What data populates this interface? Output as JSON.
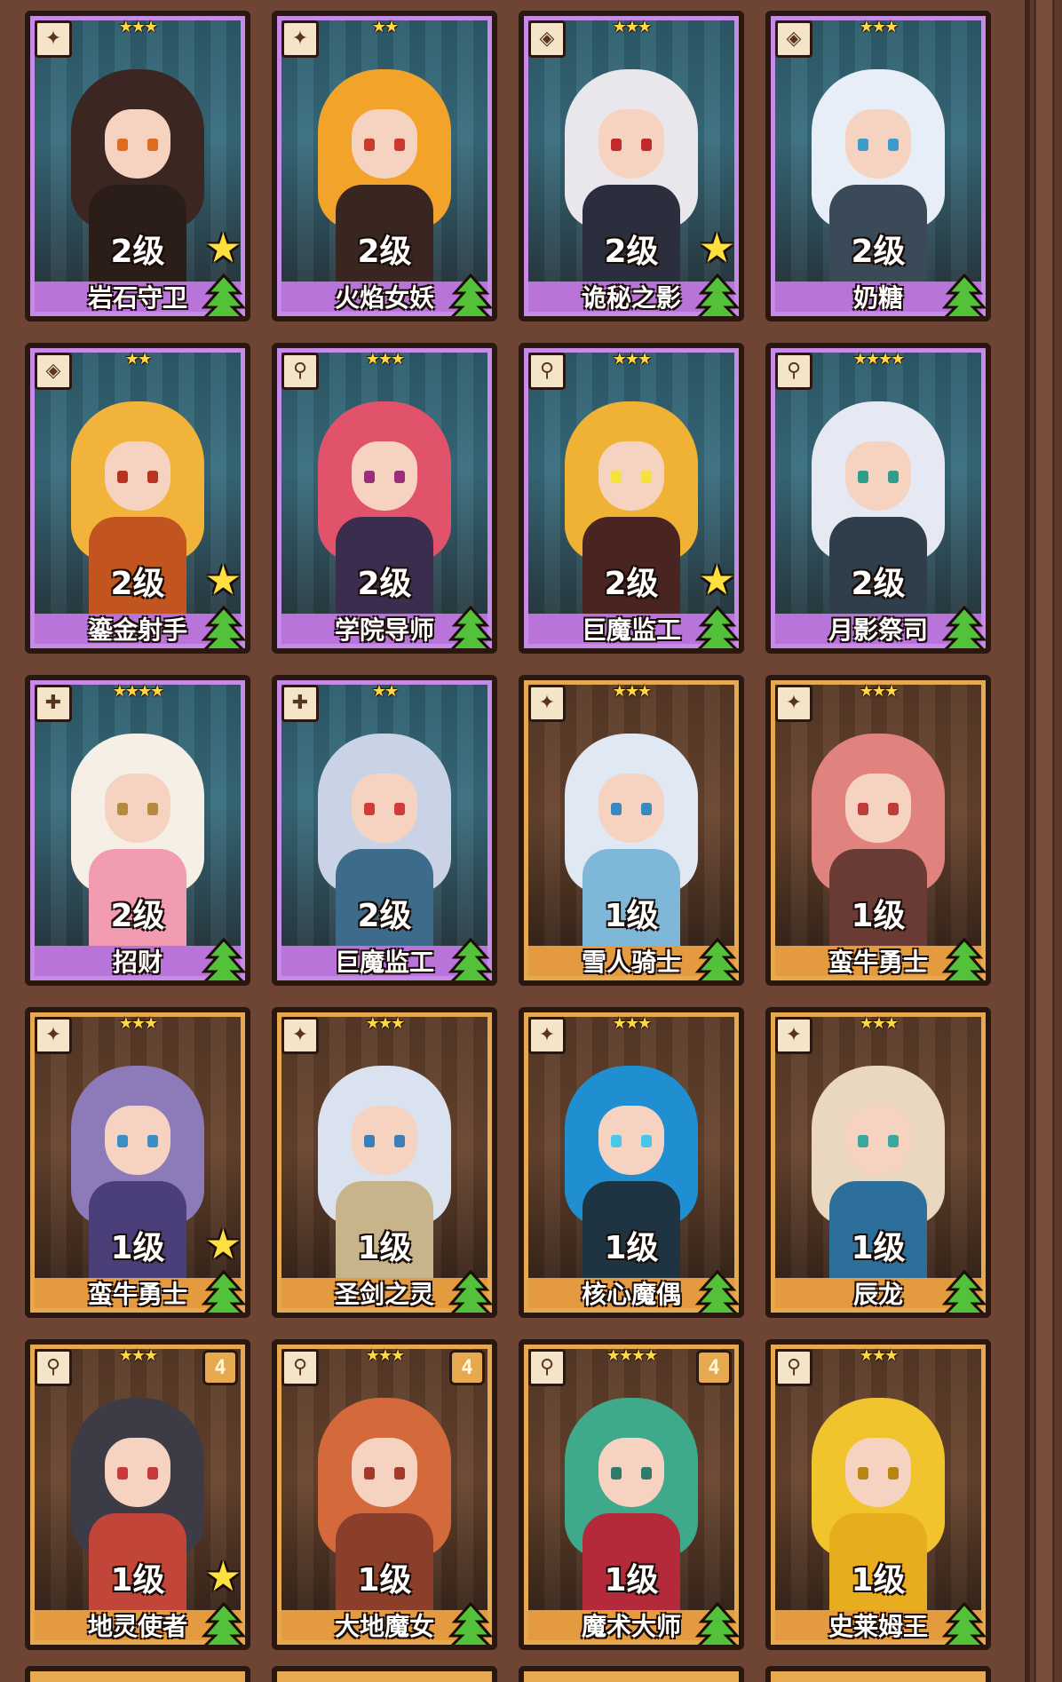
{
  "cards": [
    {
      "name": "岩石守卫",
      "level": "2级",
      "stars": "★★★",
      "frame": "purple",
      "icon": "✦",
      "rank": "",
      "gold_star": true,
      "hair": "#3b2621",
      "body": "#2b1d18",
      "eye": "#e06a20"
    },
    {
      "name": "火焰女妖",
      "level": "2级",
      "stars": "★★",
      "frame": "purple",
      "icon": "✦",
      "rank": "",
      "gold_star": false,
      "hair": "#f2a42a",
      "body": "#3a2620",
      "eye": "#c93a2e"
    },
    {
      "name": "诡秘之影",
      "level": "2级",
      "stars": "★★★",
      "frame": "purple",
      "icon": "◈",
      "rank": "",
      "gold_star": true,
      "hair": "#e9e6ec",
      "body": "#2b2f3d",
      "eye": "#c02a2a"
    },
    {
      "name": "奶糖",
      "level": "2级",
      "stars": "★★★",
      "frame": "purple",
      "icon": "◈",
      "rank": "",
      "gold_star": false,
      "hair": "#e7eef7",
      "body": "#3a4a58",
      "eye": "#3a9cc8"
    },
    {
      "name": "鎏金射手",
      "level": "2级",
      "stars": "★★",
      "frame": "purple",
      "icon": "◈",
      "rank": "",
      "gold_star": true,
      "hair": "#f1b33a",
      "body": "#c2551f",
      "eye": "#b8341f"
    },
    {
      "name": "学院导师",
      "level": "2级",
      "stars": "★★★",
      "frame": "purple",
      "icon": "⚲",
      "rank": "",
      "gold_star": false,
      "hair": "#e0536a",
      "body": "#3a2d4e",
      "eye": "#9b2e7a"
    },
    {
      "name": "巨魔监工",
      "level": "2级",
      "stars": "★★★",
      "frame": "purple",
      "icon": "⚲",
      "rank": "",
      "gold_star": true,
      "hair": "#f0b235",
      "body": "#4a2420",
      "eye": "#f6e23a"
    },
    {
      "name": "月影祭司",
      "level": "2级",
      "stars": "★★★★",
      "frame": "purple",
      "icon": "⚲",
      "rank": "",
      "gold_star": false,
      "hair": "#e6e9f3",
      "body": "#2f3e4a",
      "eye": "#2f9c8c"
    },
    {
      "name": "招财",
      "level": "2级",
      "stars": "★★★★",
      "frame": "purple",
      "icon": "✚",
      "rank": "",
      "gold_star": false,
      "hair": "#f5efe6",
      "body": "#f29cb1",
      "eye": "#b58a3e"
    },
    {
      "name": "巨魔监工",
      "level": "2级",
      "stars": "★★",
      "frame": "purple",
      "icon": "✚",
      "rank": "",
      "gold_star": false,
      "hair": "#c9d3e5",
      "body": "#3d6b8c",
      "eye": "#d23b3b"
    },
    {
      "name": "雪人骑士",
      "level": "1级",
      "stars": "★★★",
      "frame": "gold",
      "icon": "✦",
      "rank": "",
      "gold_star": false,
      "hair": "#dfe8f3",
      "body": "#7fb7d8",
      "eye": "#3a88c2"
    },
    {
      "name": "蛮牛勇士",
      "level": "1级",
      "stars": "★★★",
      "frame": "gold",
      "icon": "✦",
      "rank": "",
      "gold_star": false,
      "hair": "#e0827d",
      "body": "#6a3a35",
      "eye": "#c23b3b"
    },
    {
      "name": "蛮牛勇士",
      "level": "1级",
      "stars": "★★★",
      "frame": "gold",
      "icon": "✦",
      "rank": "",
      "gold_star": true,
      "hair": "#8d7ab8",
      "body": "#4b3f7a",
      "eye": "#3a8ec8"
    },
    {
      "name": "圣剑之灵",
      "level": "1级",
      "stars": "★★★",
      "frame": "gold",
      "icon": "✦",
      "rank": "",
      "gold_star": false,
      "hair": "#d9e2ee",
      "body": "#c7b48a",
      "eye": "#3a80b8"
    },
    {
      "name": "核心魔偶",
      "level": "1级",
      "stars": "★★★",
      "frame": "gold",
      "icon": "✦",
      "rank": "",
      "gold_star": false,
      "hair": "#1f8fd1",
      "body": "#1e3442",
      "eye": "#49c6e8"
    },
    {
      "name": "辰龙",
      "level": "1级",
      "stars": "★★★",
      "frame": "gold",
      "icon": "✦",
      "rank": "",
      "gold_star": false,
      "hair": "#e9d7c0",
      "body": "#2b6f9a",
      "eye": "#3aa89c"
    },
    {
      "name": "地灵使者",
      "level": "1级",
      "stars": "★★★",
      "frame": "gold",
      "icon": "⚲",
      "rank": "4",
      "gold_star": true,
      "hair": "#3d3b46",
      "body": "#c2453a",
      "eye": "#c63a3a"
    },
    {
      "name": "大地魔女",
      "level": "1级",
      "stars": "★★★",
      "frame": "gold",
      "icon": "⚲",
      "rank": "4",
      "gold_star": false,
      "hair": "#d46a3b",
      "body": "#8b3f2a",
      "eye": "#a33a2a"
    },
    {
      "name": "魔术大师",
      "level": "1级",
      "stars": "★★★★",
      "frame": "gold",
      "icon": "⚲",
      "rank": "4",
      "gold_star": false,
      "hair": "#3ea98b",
      "body": "#b52a3a",
      "eye": "#2f7a6a"
    },
    {
      "name": "史莱姆王",
      "level": "1级",
      "stars": "★★★",
      "frame": "gold",
      "icon": "⚲",
      "rank": "",
      "gold_star": false,
      "hair": "#f1c32c",
      "body": "#e7ad1e",
      "eye": "#b98512"
    }
  ]
}
